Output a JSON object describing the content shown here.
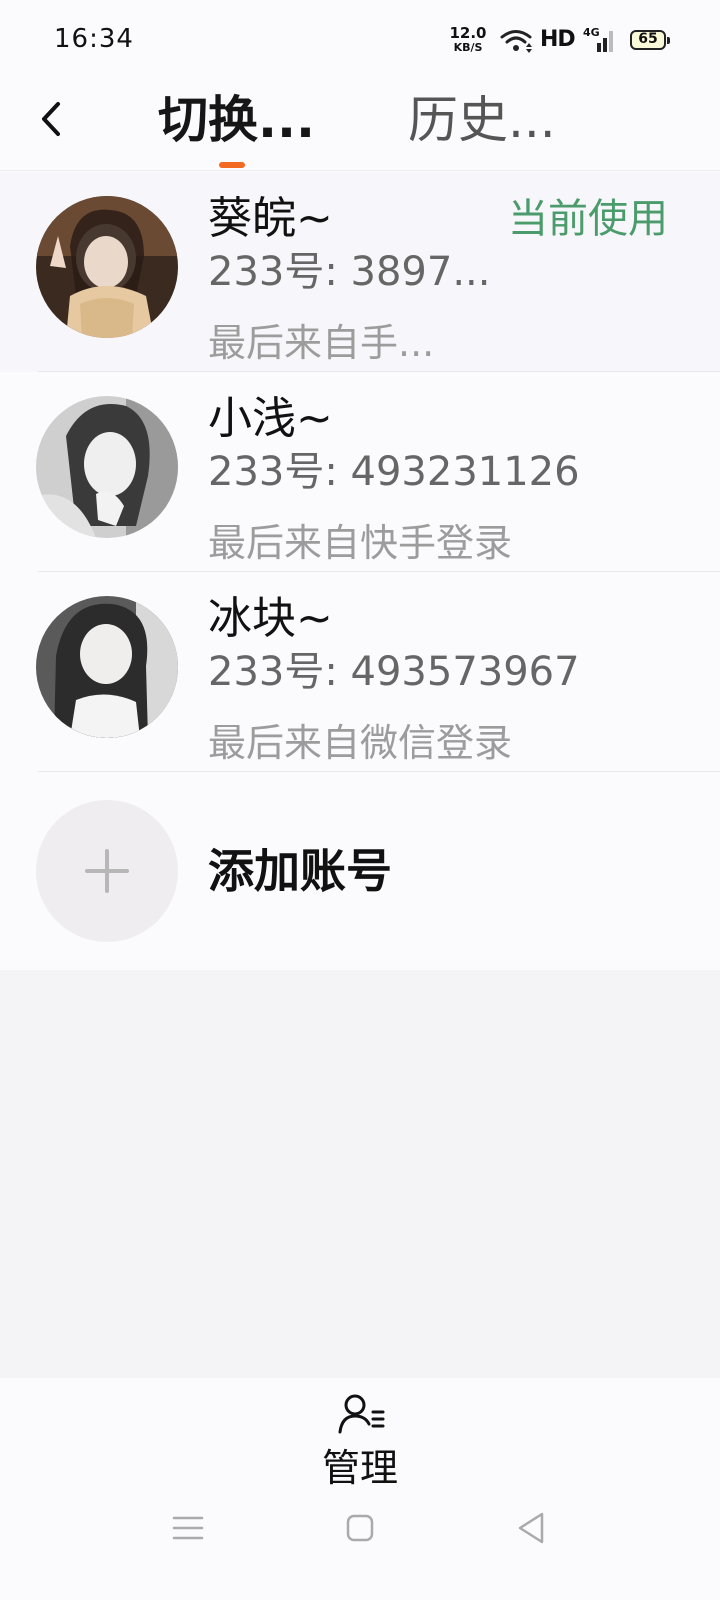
{
  "status_bar": {
    "time": "16:34",
    "net_speed_value": "12.0",
    "net_speed_unit": "KB/S",
    "hd": "HD",
    "network_type": "4G",
    "battery": "65"
  },
  "header": {
    "back_icon": "chevron-left-icon",
    "tabs": [
      {
        "label": "切换...",
        "active": true
      },
      {
        "label": "历史...",
        "active": false
      }
    ],
    "active_color": "#f26b21"
  },
  "accounts": [
    {
      "name": "葵皖~",
      "id_line": "233号: 3897...",
      "source": "最后来自手...",
      "status": "当前使用",
      "current": true
    },
    {
      "name": "小浅~",
      "id_line": "233号: 493231126",
      "source": "最后来自快手登录",
      "current": false
    },
    {
      "name": "冰块~",
      "id_line": "233号: 493573967",
      "source": "最后来自微信登录",
      "current": false
    }
  ],
  "add_account": {
    "icon": "plus-icon",
    "label": "添加账号"
  },
  "bottom": {
    "manage_icon": "user-list-icon",
    "manage_label": "管理"
  },
  "system_nav": [
    "menu-icon",
    "home-icon",
    "back-triangle-icon"
  ],
  "colors": {
    "current_badge": "#4b9b6b",
    "tab_indicator": "#f26b21"
  }
}
